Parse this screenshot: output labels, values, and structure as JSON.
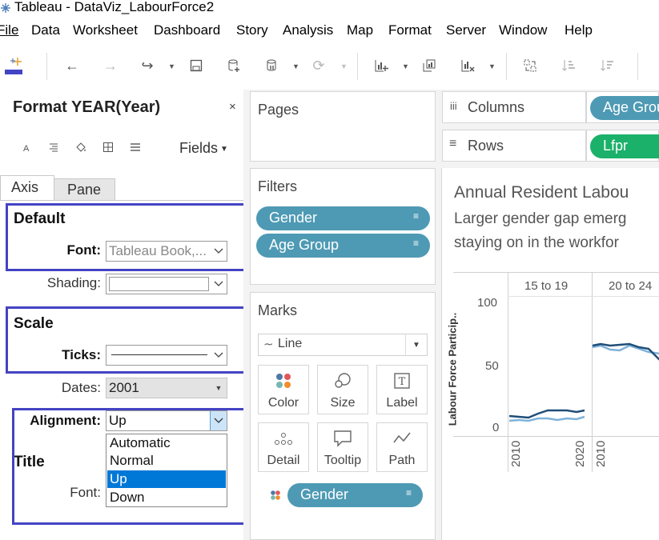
{
  "window": {
    "title": "Tableau - DataViz_LabourForce2"
  },
  "menu": {
    "items": [
      {
        "label": "File",
        "hot": "F"
      },
      {
        "label": "Data",
        "hot": "D"
      },
      {
        "label": "Worksheet",
        "hot": "W"
      },
      {
        "label": "Dashboard",
        "hot": "b"
      },
      {
        "label": "Story",
        "hot": "S"
      },
      {
        "label": "Analysis",
        "hot": "A"
      },
      {
        "label": "Map",
        "hot": "M"
      },
      {
        "label": "Format",
        "hot": "o"
      },
      {
        "label": "Server",
        "hot": "S"
      },
      {
        "label": "Window",
        "hot": "n"
      },
      {
        "label": "Help",
        "hot": "H"
      }
    ]
  },
  "toolbar": {
    "icons": [
      "tableau-logo-icon",
      "undo-icon",
      "redo-icon",
      "swap-icon",
      "save-icon",
      "new-datasource-icon",
      "pause-updates-icon",
      "refresh-icon",
      "new-worksheet-icon",
      "duplicate-sheet-icon",
      "clear-sheet-icon",
      "swap-rows-columns-icon",
      "sort-ascending-icon",
      "sort-descending-icon"
    ]
  },
  "format_pane": {
    "title": "Format YEAR(Year)",
    "close": "×",
    "fields_label": "Fields",
    "tabs": {
      "axis": "Axis",
      "pane": "Pane"
    },
    "default": {
      "heading": "Default",
      "font_label": "Font:",
      "font_value": "Tableau Book,...",
      "shading_label": "Shading:"
    },
    "scale": {
      "heading": "Scale",
      "ticks_label": "Ticks:",
      "dates_label": "Dates:",
      "dates_value": "2001",
      "alignment_label": "Alignment:",
      "alignment_value": "Up"
    },
    "title_section": {
      "heading": "Title",
      "font_label": "Font:"
    },
    "alignment_options": [
      "Automatic",
      "Normal",
      "Up",
      "Down"
    ],
    "alignment_selected": "Up"
  },
  "pages": {
    "title": "Pages"
  },
  "filters": {
    "title": "Filters",
    "pills": [
      "Gender",
      "Age Group"
    ]
  },
  "marks": {
    "title": "Marks",
    "type": "Line",
    "buttons": [
      "Color",
      "Size",
      "Label",
      "Detail",
      "Tooltip",
      "Path"
    ],
    "color_pill": "Gender"
  },
  "shelves": {
    "columns_label": "Columns",
    "columns_pill": "Age Grou",
    "rows_label": "Rows",
    "rows_pill": "Lfpr"
  },
  "view": {
    "title": "Annual Resident Labou",
    "subtitle_line1": "Larger gender gap  emerg",
    "subtitle_line2": "staying on in the workfor",
    "y_axis_label": "Labour Force Particip..",
    "panel_headers": [
      "15 to 19",
      "20 to 24"
    ],
    "y_ticks": [
      "100",
      "50",
      "0"
    ],
    "x_ticks": [
      "2010",
      "2020",
      "2010"
    ]
  },
  "colors": {
    "pill_blue": "#4e9ab4",
    "pill_green": "#1bb16a",
    "highlight": "#4343c4",
    "selection": "#0078d7",
    "men_line": "#1f4e79",
    "women_line": "#7fb2d9"
  }
}
